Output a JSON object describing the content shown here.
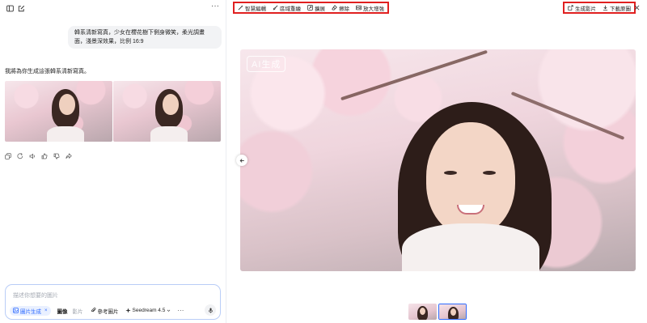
{
  "left_panel": {
    "user_prompt": "韓系清新寫真，少女在櫻花樹下側身微笑，柔光調畫面，淺景深效果，比例 16:9",
    "assistant_reply": "我將為你生成這張韓系清新寫真。",
    "result_images": [
      "thumbnail-1",
      "thumbnail-2"
    ],
    "action_icons": [
      "copy-icon",
      "refresh-icon",
      "speaker-icon",
      "thumbs-up-icon",
      "thumbs-down-icon",
      "share-icon"
    ]
  },
  "composer": {
    "placeholder": "描述你想要的圖片",
    "image_chip_label": "圖片生成",
    "chip_close": "×",
    "mode_image": "圖像",
    "mode_video": "影片",
    "reference_label": "參考圖片",
    "model_label": "Seedream 4.5",
    "more_label": "···"
  },
  "toolbar": {
    "left_tools": [
      {
        "label": "智慧編輯",
        "icon": "magic-wand-icon"
      },
      {
        "label": "區域重繪",
        "icon": "brush-icon"
      },
      {
        "label": "擴展",
        "icon": "expand-icon"
      },
      {
        "label": "擦除",
        "icon": "eraser-icon"
      },
      {
        "label": "放大增強",
        "icon": "hd-upscale-icon"
      }
    ],
    "right_tools": [
      {
        "label": "生成影片",
        "icon": "video-generate-icon"
      },
      {
        "label": "下載原圖",
        "icon": "download-icon"
      }
    ],
    "highlight_color": "#e02020"
  },
  "viewer": {
    "watermark": "AI生成",
    "thumbnails": [
      "thumbnail-1",
      "thumbnail-2"
    ],
    "selected_thumbnail": 1
  },
  "colors": {
    "accent": "#2f6bff",
    "composer_border": "#b9cdf7",
    "bubble": "#f2f3f5"
  }
}
